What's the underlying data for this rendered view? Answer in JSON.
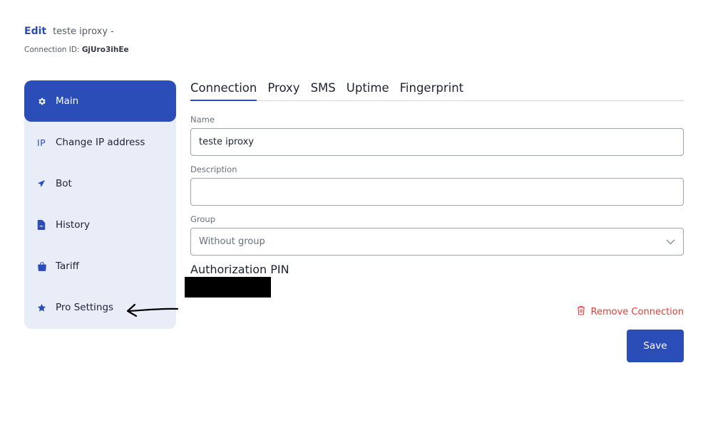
{
  "header": {
    "edit_label": "Edit",
    "connection_name": "teste iproxy -",
    "connection_id_label": "Connection ID:",
    "connection_id": "GjUro3ihEe"
  },
  "sidebar": {
    "items": [
      {
        "label": "Main",
        "icon": "gear-icon",
        "active": true
      },
      {
        "label": "Change IP address",
        "icon": "ip-icon",
        "icon_text": "IP"
      },
      {
        "label": "Bot",
        "icon": "paper-plane-icon"
      },
      {
        "label": "History",
        "icon": "document-icon"
      },
      {
        "label": "Tariff",
        "icon": "shopping-bag-icon"
      },
      {
        "label": "Pro Settings",
        "icon": "star-icon"
      }
    ]
  },
  "tabs": [
    "Connection",
    "Proxy",
    "SMS",
    "Uptime",
    "Fingerprint"
  ],
  "form": {
    "name_label": "Name",
    "name_value": "teste iproxy",
    "description_label": "Description",
    "description_value": "",
    "group_label": "Group",
    "group_value": "Without group",
    "auth_title": "Authorization PIN"
  },
  "actions": {
    "remove_label": "Remove Connection",
    "save_label": "Save"
  },
  "colors": {
    "accent": "#2a4db8",
    "sidebar_bg": "#e9edf8",
    "danger": "#e53b3b"
  }
}
